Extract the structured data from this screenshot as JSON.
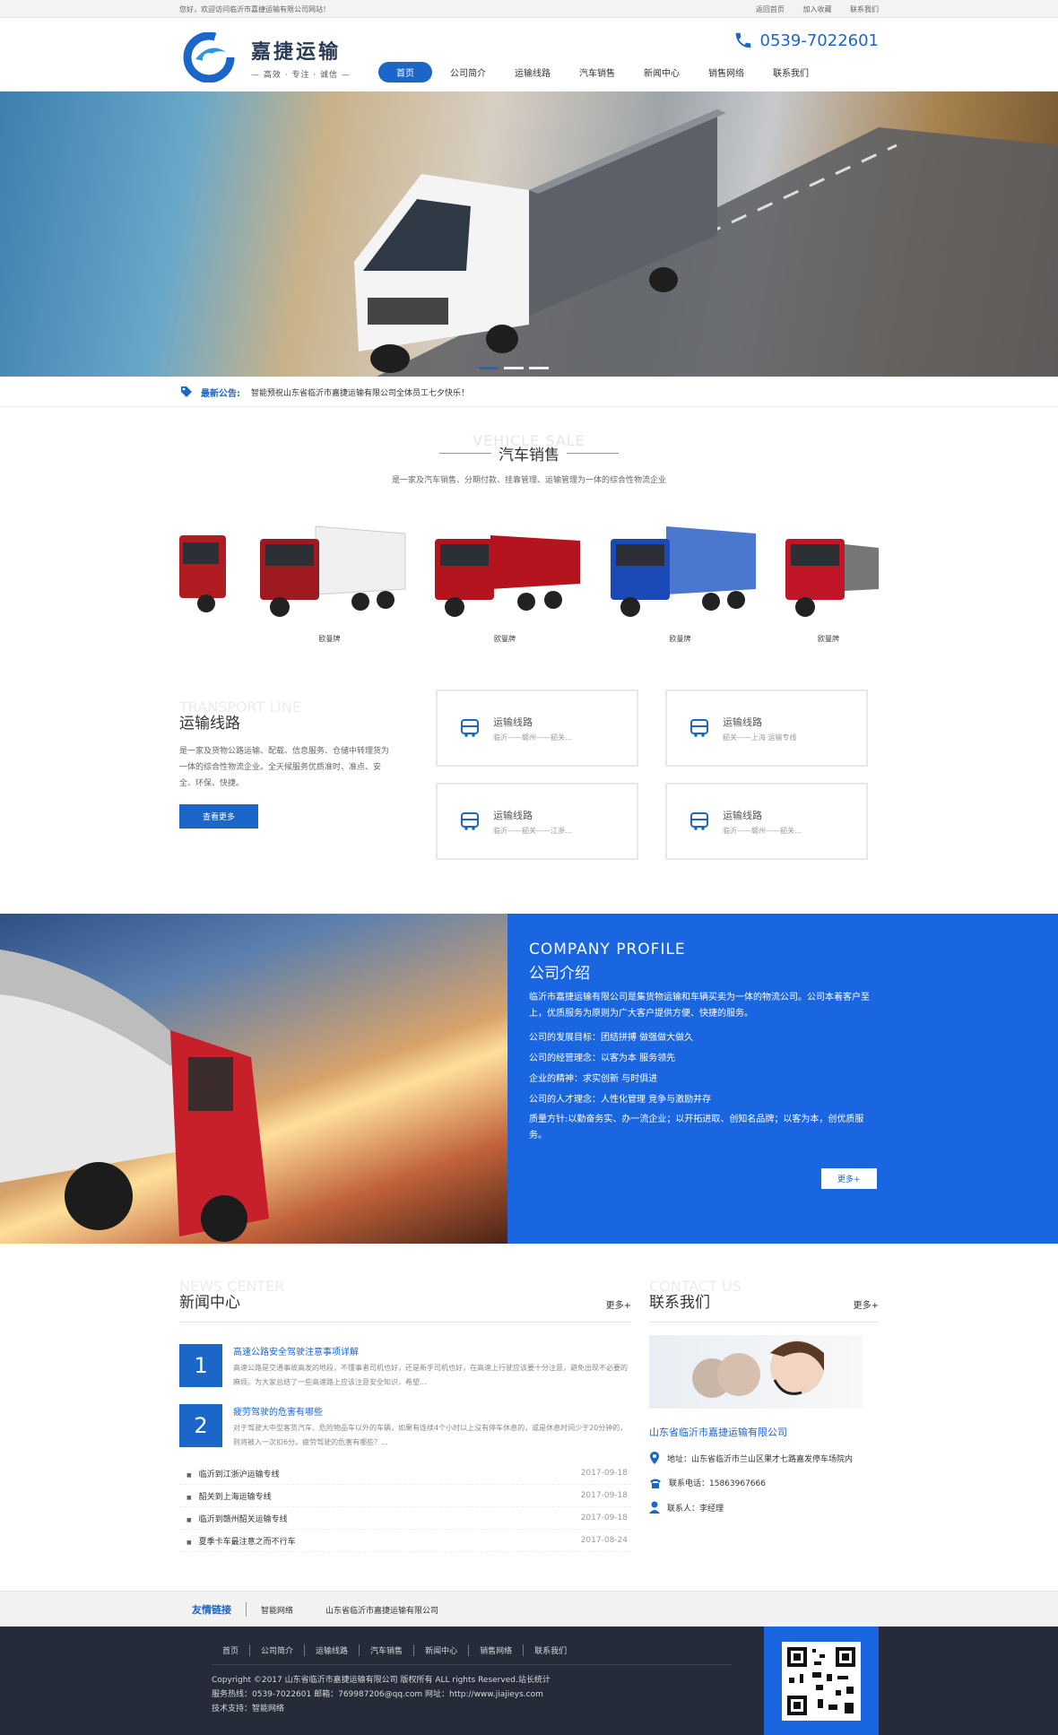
{
  "topbar": {
    "welcome": "您好，欢迎访问临沂市嘉捷运输有限公司网站！",
    "links": [
      "返回首页",
      "加入收藏",
      "联系我们"
    ]
  },
  "header": {
    "logo_name": "嘉捷运输",
    "logo_slogan": "— 高效 · 专注 · 诚信 —",
    "phone": "0539-7022601"
  },
  "nav": [
    "首页",
    "公司简介",
    "运输线路",
    "汽车销售",
    "新闻中心",
    "销售网络",
    "联系我们"
  ],
  "notice": {
    "label": "最新公告:",
    "text": "智能预祝山东省临沂市嘉捷运输有限公司全体员工七夕快乐！"
  },
  "vehicle": {
    "en": "VEHICLE SALE",
    "cn": "汽车销售",
    "desc": "是一家及汽车销售、分期付款、挂靠管理、运输管理为一体的综合性物流企业",
    "cars": [
      {
        "label": "",
        "color": "#b01c22"
      },
      {
        "label": "欧曼牌",
        "color": "#9d1a20"
      },
      {
        "label": "欧曼牌",
        "color": "#b3141d"
      },
      {
        "label": "欧曼牌",
        "color": "#1b49b5"
      },
      {
        "label": "欧曼牌",
        "color": "#c11627"
      }
    ]
  },
  "lines": {
    "en": "TRANSPORT LINE",
    "cn": "运输线路",
    "desc": "是一家及货物公路运输、配载、信息服务、仓储中转理货为一体的综合性物流企业。全天候服务优质准时、准点、安全、环保、快捷。",
    "more": "查看更多",
    "cards": [
      {
        "title": "运输线路",
        "route": "临沂——赣州——韶关..."
      },
      {
        "title": "运输线路",
        "route": "韶关——上海 运输专线"
      },
      {
        "title": "运输线路",
        "route": "临沂——韶关——江浙..."
      },
      {
        "title": "运输线路",
        "route": "临沂——赣州——韶关..."
      }
    ]
  },
  "profile": {
    "en": "COMPANY PROFILE",
    "cn": "公司介绍",
    "para": "临沂市嘉捷运输有限公司是集货物运输和车辆买卖为一体的物流公司。公司本着客户至上，优质服务为原则为广大客户提供方便、快捷的服务。",
    "items": [
      "公司的发展目标：团结拼搏 做强做大做久",
      "公司的经营理念：以客为本 服务领先",
      "企业的精神：求实创新 与时俱进",
      "公司的人才理念：人性化管理 竞争与激励并存",
      "质量方针:以勤奋务实、办一流企业；以开拓进取、创知名品牌；以客为本，创优质服务。"
    ],
    "more": "更多+"
  },
  "news": {
    "en": "NEWS CENTER",
    "cn": "新闻中心",
    "more": "更多+",
    "featured": [
      {
        "num": "1",
        "title": "高速公路安全驾驶注意事项详解",
        "desc": "高速公路是交通事故高发的地段，不懂事者司机也好，还是新手司机也好，在高速上行驶应该要十分注意，避免出现不必要的麻烦。为大家总结了一些高速路上应该注意安全知识，希望..."
      },
      {
        "num": "2",
        "title": "疲劳驾驶的危害有哪些",
        "desc": "对于驾驶大中型客货汽车、危险物品车以外的车辆，如果有连续4个小时以上没有停车休息的，或是休息时间少于20分钟的，则将被入一次扣6分。疲劳驾驶的危害有哪些？..."
      }
    ],
    "list": [
      {
        "title": "临沂到江浙沪运输专线",
        "date": "2017-09-18"
      },
      {
        "title": "韶关到上海运输专线",
        "date": "2017-09-18"
      },
      {
        "title": "临沂到赣州韶关运输专线",
        "date": "2017-09-18"
      },
      {
        "title": "夏季卡车最注意之而不行车",
        "date": "2017-08-24"
      }
    ]
  },
  "contact": {
    "en": "CONTACT US",
    "cn": "联系我们",
    "more": "更多+",
    "company": "山东省临沂市嘉捷运输有限公司",
    "address": "地址：山东省临沂市兰山区果才七路嘉发停车场院内",
    "tel": "联系电话：15863967666",
    "person": "联系人：李经理"
  },
  "friends": {
    "label": "友情链接",
    "items": [
      "智能网络",
      "山东省临沂市嘉捷运输有限公司"
    ]
  },
  "footer": {
    "nav": [
      "首页",
      "公司简介",
      "运输线路",
      "汽车销售",
      "新闻中心",
      "销售网络",
      "联系我们"
    ],
    "copyright": "Copyright ©2017 山东省临沂市嘉捷运输有限公司 版权所有 ALL rights Reserved.站长统计",
    "service": "服务热线：0539-7022601 邮箱：769987206@qq.com 网址：http://www.jiajieys.com",
    "support": "技术支持：智能网络"
  },
  "colors": {
    "brand": "#1a66c9",
    "profile_bg": "#1a66e0",
    "footer_bg": "#252b38"
  }
}
